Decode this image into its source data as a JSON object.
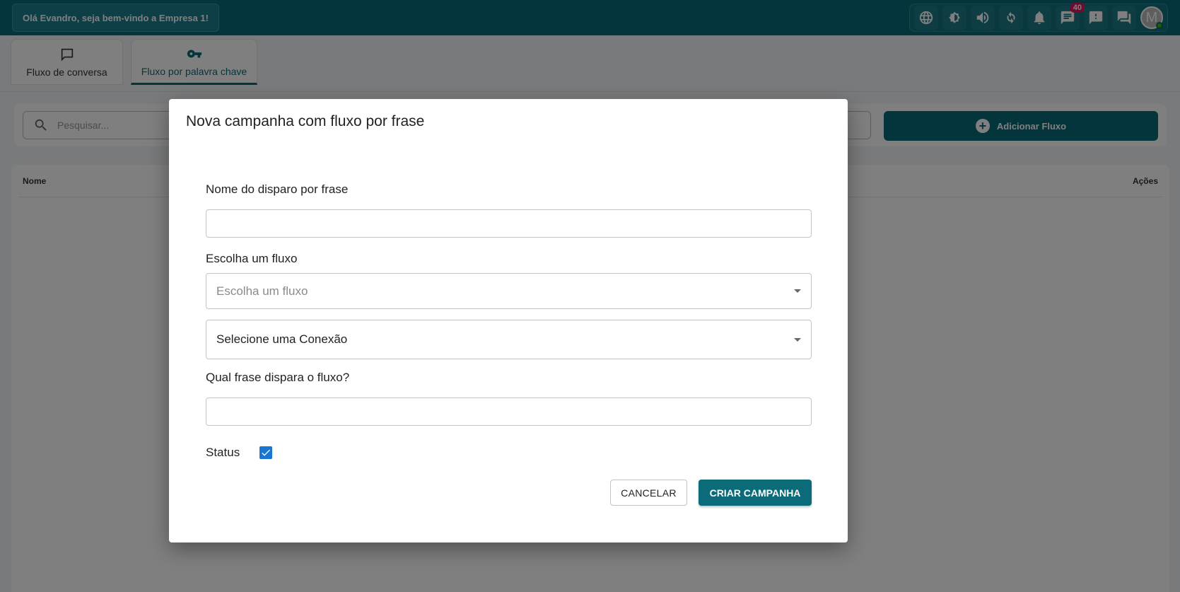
{
  "header": {
    "greeting": "Olá Evandro, seja bem-vindo a Empresa 1!",
    "icons": [
      "globe-icon",
      "contrast-icon",
      "volume-icon",
      "refresh-icon",
      "bell-icon",
      "chat-icon",
      "feedback-icon",
      "forum-icon"
    ],
    "chat_badge": "40",
    "avatar_initial": "M"
  },
  "tabs": [
    {
      "label": "Fluxo de conversa",
      "icon": "chat-bubble-icon",
      "active": false
    },
    {
      "label": "Fluxo por palavra chave",
      "icon": "key-icon",
      "active": true
    }
  ],
  "search": {
    "placeholder": "Pesquisar..."
  },
  "toolbar": {
    "add_label": "Adicionar Fluxo"
  },
  "table": {
    "columns": [
      "Nome",
      "Ações"
    ]
  },
  "modal": {
    "title": "Nova campanha com fluxo por frase",
    "name_label": "Nome do disparo por frase",
    "name_value": "",
    "flow_label": "Escolha um fluxo",
    "flow_placeholder": "Escolha um fluxo",
    "connection_value": "Selecione uma Conexão",
    "phrase_label": "Qual frase dispara o fluxo?",
    "phrase_value": "",
    "status_label": "Status",
    "status_checked": true,
    "cancel_label": "CANCELAR",
    "create_label": "CRIAR CAMPANHA"
  },
  "colors": {
    "primary": "#0b6b78",
    "badge": "#d81b60",
    "checkbox": "#1976d2"
  }
}
